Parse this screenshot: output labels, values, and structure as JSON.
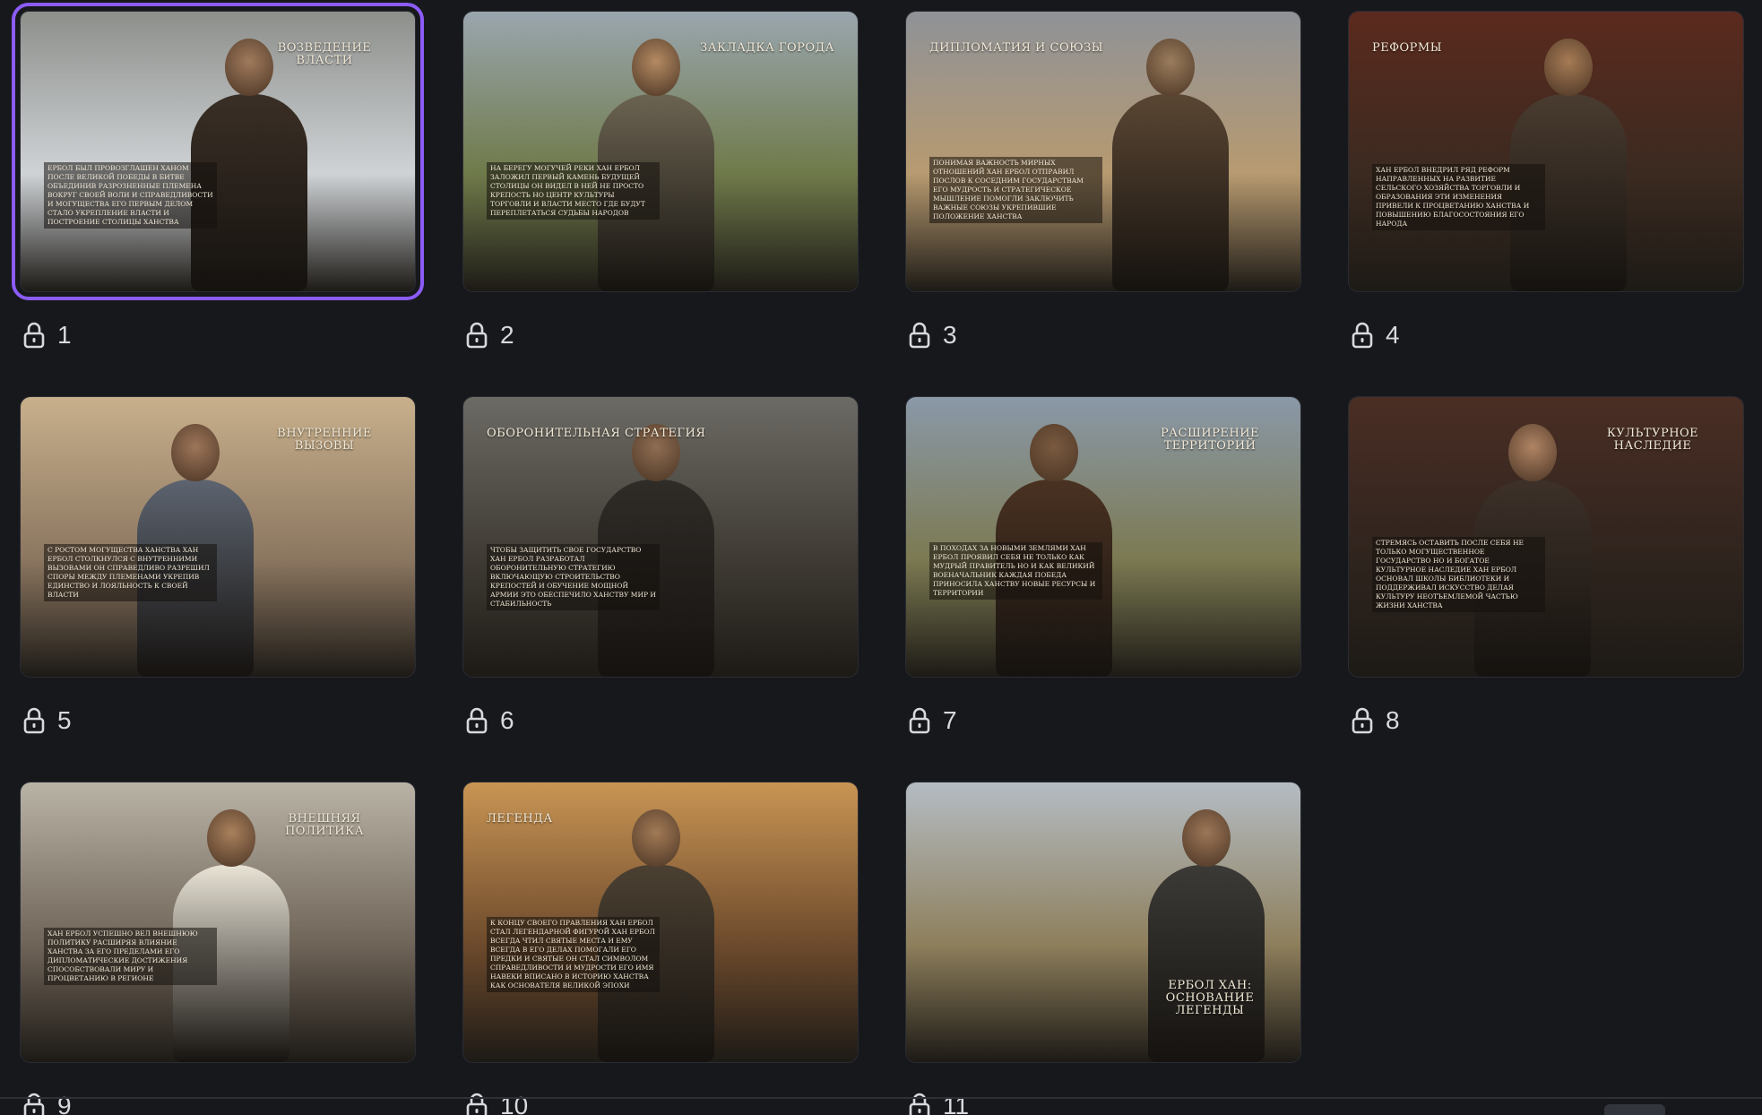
{
  "slides": [
    {
      "number": "1",
      "title": "Возведение власти",
      "caption": "Ербол был провозглашен ханом после великой победы в битве объединив разрозненные племена вокруг своей воли и справедливости и могущества его первым делом стало укрепление власти и построение столицы ханства",
      "selected": true,
      "locked": true,
      "palette": {
        "sky": "#8d8f8b",
        "ground": "#cfd3d6",
        "figure": "#3a2f26",
        "head": "#a07a5c"
      }
    },
    {
      "number": "2",
      "title": "Закладка города",
      "caption": "На берегу могучей реки хан Ербол заложил первый камень будущей столицы он видел в ней не просто крепость но центр культуры торговли и власти место где будут переплетаться судьбы народов",
      "selected": false,
      "locked": true,
      "palette": {
        "sky": "#9aa6ae",
        "ground": "#6f7a4a",
        "figure": "#6c6452",
        "head": "#b48a62"
      }
    },
    {
      "number": "3",
      "title": "Дипломатия и союзы",
      "caption": "Понимая важность мирных отношений хан Ербол отправил послов к соседним государствам его мудрость и стратегическое мышление помогли заключить важные союзы укрепившие положение ханства",
      "selected": false,
      "locked": true,
      "palette": {
        "sky": "#8f9298",
        "ground": "#b79a70",
        "figure": "#5a4633",
        "head": "#9b7d5d"
      }
    },
    {
      "number": "4",
      "title": "Реформы",
      "caption": "Хан Ербол внедрил ряд реформ направленных на развитие сельского хозяйства торговли и образования эти изменения привели к процветанию ханства и повышению благосостояния его народа",
      "selected": false,
      "locked": true,
      "palette": {
        "sky": "#5b2a1e",
        "ground": "#3b2a20",
        "figure": "#4a3c30",
        "head": "#a67b55"
      }
    },
    {
      "number": "5",
      "title": "Внутренние вызовы",
      "caption": "С ростом могущества ханства хан Ербол столкнулся с внутренними вызовами он справедливо разрешил споры между племенами укрепив единство и лояльность к своей власти",
      "selected": false,
      "locked": true,
      "palette": {
        "sky": "#c8b08c",
        "ground": "#8b7660",
        "figure": "#5d6470",
        "head": "#9d7559"
      }
    },
    {
      "number": "6",
      "title": "Оборонительная стратегия",
      "caption": "Чтобы защитить свое государство хан Ербол разработал оборонительную стратегию включающую строительство крепостей и обучение мощной армии это обеспечило ханству мир и стабильность",
      "selected": false,
      "locked": true,
      "palette": {
        "sky": "#6c6a64",
        "ground": "#3f3b34",
        "figure": "#2f2c28",
        "head": "#8f6e52"
      }
    },
    {
      "number": "7",
      "title": "Расширение территорий",
      "caption": "В походах за новыми землями хан Ербол проявил себя не только как мудрый правитель но и как великий военачальник каждая победа приносила ханству новые ресурсы и территории",
      "selected": false,
      "locked": true,
      "palette": {
        "sky": "#8a98a8",
        "ground": "#7c7a52",
        "figure": "#4a3222",
        "head": "#7a5a40"
      }
    },
    {
      "number": "8",
      "title": "Культурное наследие",
      "caption": "Стремясь оставить после себя не только могущественное государство но и богатое культурное наследие хан Ербол основал школы библиотеки и поддерживал искусство делая культуру неотъемлемой частью жизни ханства",
      "selected": false,
      "locked": true,
      "palette": {
        "sky": "#4a2e24",
        "ground": "#2f241e",
        "figure": "#3d3129",
        "head": "#b08464"
      }
    },
    {
      "number": "9",
      "title": "Внешняя политика",
      "caption": "Хан Ербол успешно вел внешнюю политику расширяя влияние ханства за его пределами его дипломатические достижения способствовали миру и процветанию в регионе",
      "selected": false,
      "locked": true,
      "palette": {
        "sky": "#b9b3a6",
        "ground": "#6f6458",
        "figure": "#e9e3d6",
        "head": "#a9805c"
      }
    },
    {
      "number": "10",
      "title": "Легенда",
      "caption": "К концу своего правления хан Ербол стал легендарной фигурой хан Ербол всегда чтил святые места и ему всегда в его делах помогали его предки и святые он стал символом справедливости и мудрости его имя навеки вписано в историю ханства как основателя великой эпохи",
      "selected": false,
      "locked": true,
      "palette": {
        "sky": "#c99554",
        "ground": "#6d4a2c",
        "figure": "#4b4032",
        "head": "#a27a56"
      }
    },
    {
      "number": "11",
      "title": "Ербол Хан: Основание легенды",
      "caption": "",
      "selected": false,
      "locked": true,
      "palette": {
        "sky": "#b4bcc3",
        "ground": "#8e7f5c",
        "figure": "#3b3a36",
        "head": "#9c7657"
      }
    }
  ],
  "colors": {
    "background": "#17181c",
    "selection": "#8b5cf6",
    "text": "#d8d9de"
  }
}
